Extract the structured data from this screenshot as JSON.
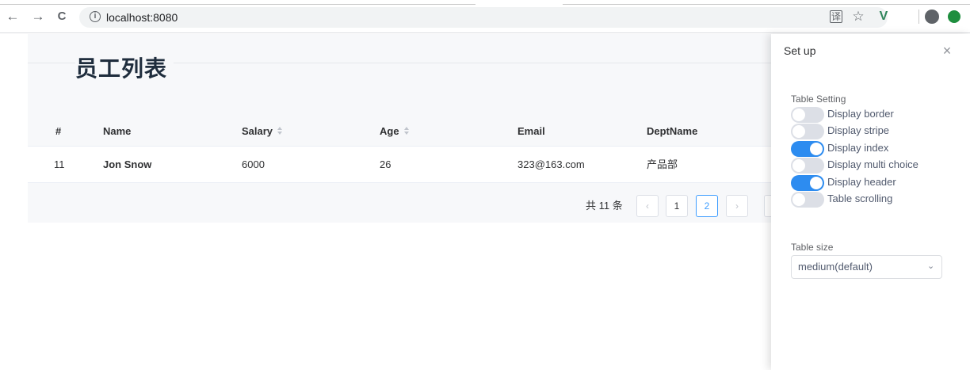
{
  "browser": {
    "back_icon": "←",
    "forward_icon": "→",
    "reload_icon": "C",
    "info_icon": "i",
    "url": "localhost:8080",
    "translate_icon": "译",
    "star_icon": "☆",
    "vue_icon": "V",
    "profile_icon": "●",
    "extension_icon": "●"
  },
  "page": {
    "title": "员工列表"
  },
  "table": {
    "columns": [
      "#",
      "Name",
      "Salary",
      "Age",
      "Email",
      "DeptName"
    ],
    "rows": [
      {
        "index": "11",
        "name": "Jon Snow",
        "salary": "6000",
        "age": "26",
        "email": "323@163.com",
        "dept": "产品部"
      }
    ]
  },
  "pagination": {
    "total": "共 11 条",
    "prev": "‹",
    "pages": [
      "1",
      "2"
    ],
    "current": 2,
    "next": "›"
  },
  "drawer": {
    "title": "Set up",
    "close_icon": "×",
    "table_setting_label": "Table Setting",
    "switches": [
      {
        "label": "Display border",
        "on": false
      },
      {
        "label": "Display stripe",
        "on": false
      },
      {
        "label": "Display index",
        "on": true
      },
      {
        "label": "Display multi choice",
        "on": false
      },
      {
        "label": "Display header",
        "on": true
      },
      {
        "label": "Table scrolling",
        "on": false
      }
    ],
    "table_size_label": "Table size",
    "table_size_value": "medium(default)",
    "select_arrow": "⌄"
  },
  "colors": {
    "accent": "#2d8cf0",
    "pager_active": "#409eff"
  }
}
